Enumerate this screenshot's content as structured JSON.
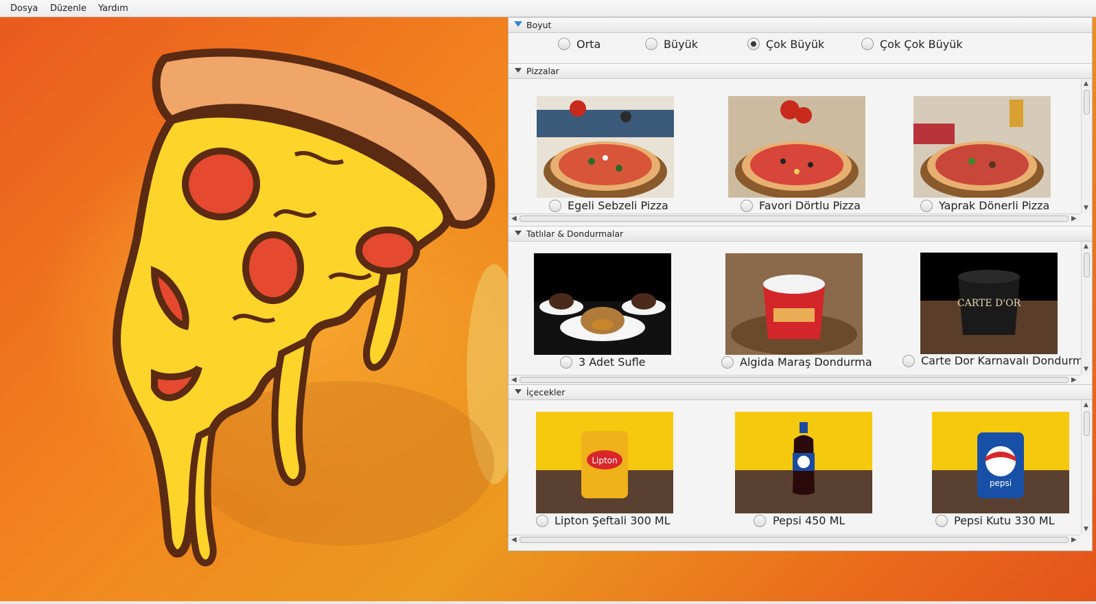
{
  "menu": [
    "Dosya",
    "Düzenle",
    "Yardım"
  ],
  "boyut": {
    "title": "Boyut",
    "options": [
      "Orta",
      "Büyük",
      "Çok Büyük",
      "Çok Çok Büyük"
    ],
    "selected": "Çok Büyük"
  },
  "pizzalar": {
    "title": "Pizzalar",
    "items": [
      "Egeli Sebzeli Pizza",
      "Favori Dörtlu Pizza",
      "Yaprak Dönerli Pizza"
    ]
  },
  "tatlilar": {
    "title": "Tatlılar & Dondurmalar",
    "items": [
      "3 Adet Sufle",
      "Algida Maraş Dondurma",
      "Carte Dor Karnavalı Dondurma"
    ]
  },
  "icecekler": {
    "title": "İçecekler",
    "items": [
      "Lipton Şeftali 300 ML",
      "Pepsi 450 ML",
      "Pepsi Kutu 330 ML"
    ]
  },
  "product_images": {
    "lipton_brand": "Lipton",
    "pepsi_brand": "pepsi",
    "pepsi_bottle_brand": "pepsi",
    "carte_dor_brand": "CARTE D'OR"
  },
  "colors": {
    "panel": "#f4f4f4",
    "accent": "#2d8ad3",
    "background_orange": "#ea6a1c",
    "pizza_cheese": "#fcd42a",
    "pepperoni": "#e5492f"
  }
}
